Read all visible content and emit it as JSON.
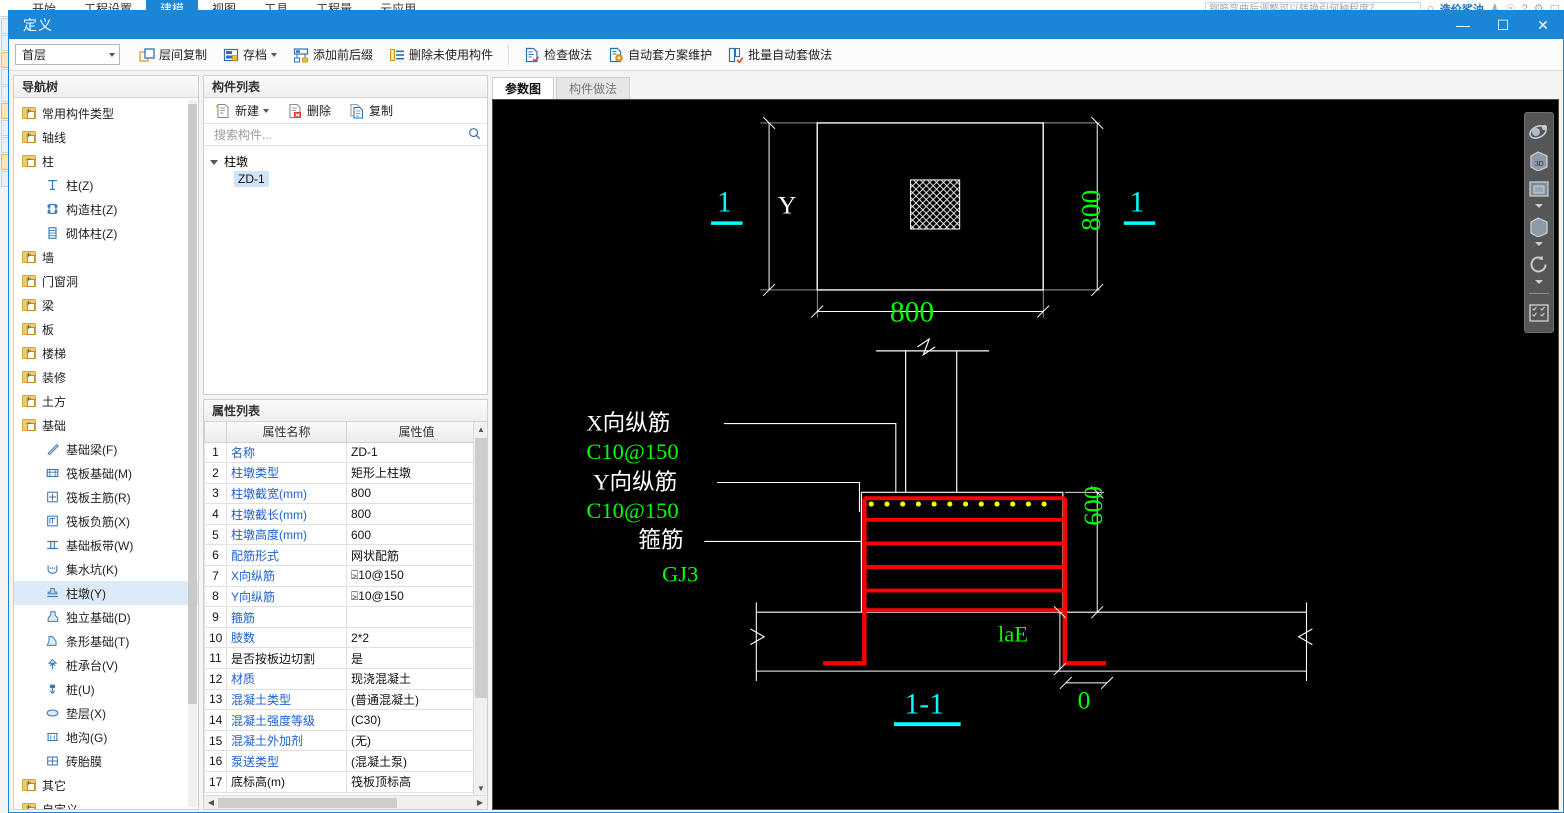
{
  "background_app": {
    "menu_items": [
      "开始",
      "工程设置",
      "建模",
      "视图",
      "工具",
      "工程量",
      "云应用"
    ],
    "active_menu": "建模",
    "search_placeholder": "钢筋弯曲后调整可以转换引何种程度？",
    "account_label": "造价鲨油",
    "help_glyph": "?"
  },
  "window": {
    "title": "定义",
    "minimize": "—",
    "maximize": "☐",
    "close": "✕"
  },
  "toolbar": {
    "floor_select": {
      "value": "首层",
      "options": [
        "首层"
      ]
    },
    "buttons": [
      {
        "label": "层间复制",
        "icon": "copy-between-floors-icon",
        "dropdown": false
      },
      {
        "label": "存档",
        "icon": "archive-icon",
        "dropdown": true
      },
      {
        "label": "添加前后缀",
        "icon": "add-prefix-suffix-icon",
        "dropdown": false
      },
      {
        "label": "删除未使用构件",
        "icon": "delete-unused-icon",
        "dropdown": false
      },
      {
        "label": "检查做法",
        "icon": "check-method-icon",
        "dropdown": false
      },
      {
        "label": "自动套方案维护",
        "icon": "auto-scheme-maintain-icon",
        "dropdown": false
      },
      {
        "label": "批量自动套做法",
        "icon": "batch-auto-method-icon",
        "dropdown": false
      }
    ]
  },
  "nav_panel": {
    "title": "导航树",
    "items": [
      {
        "label": "常用构件类型",
        "type": "folder",
        "state": "collapsed",
        "depth": 0
      },
      {
        "label": "轴线",
        "type": "folder",
        "state": "collapsed",
        "depth": 0
      },
      {
        "label": "柱",
        "type": "folder",
        "state": "expanded",
        "depth": 0
      },
      {
        "label": "柱(Z)",
        "type": "leaf",
        "icon": "column-icon",
        "depth": 1
      },
      {
        "label": "构造柱(Z)",
        "type": "leaf",
        "icon": "structural-column-icon",
        "depth": 1
      },
      {
        "label": "砌体柱(Z)",
        "type": "leaf",
        "icon": "masonry-column-icon",
        "depth": 1
      },
      {
        "label": "墙",
        "type": "folder",
        "state": "collapsed",
        "depth": 0
      },
      {
        "label": "门窗洞",
        "type": "folder",
        "state": "collapsed",
        "depth": 0
      },
      {
        "label": "梁",
        "type": "folder",
        "state": "collapsed",
        "depth": 0
      },
      {
        "label": "板",
        "type": "folder",
        "state": "collapsed",
        "depth": 0
      },
      {
        "label": "楼梯",
        "type": "folder",
        "state": "collapsed",
        "depth": 0
      },
      {
        "label": "装修",
        "type": "folder",
        "state": "collapsed",
        "depth": 0
      },
      {
        "label": "土方",
        "type": "folder",
        "state": "collapsed",
        "depth": 0
      },
      {
        "label": "基础",
        "type": "folder",
        "state": "expanded",
        "depth": 0
      },
      {
        "label": "基础梁(F)",
        "type": "leaf",
        "icon": "foundation-beam-icon",
        "depth": 1
      },
      {
        "label": "筏板基础(M)",
        "type": "leaf",
        "icon": "raft-foundation-icon",
        "depth": 1
      },
      {
        "label": "筏板主筋(R)",
        "type": "leaf",
        "icon": "raft-main-rebar-icon",
        "depth": 1
      },
      {
        "label": "筏板负筋(X)",
        "type": "leaf",
        "icon": "raft-negative-rebar-icon",
        "depth": 1
      },
      {
        "label": "基础板带(W)",
        "type": "leaf",
        "icon": "foundation-slab-band-icon",
        "depth": 1
      },
      {
        "label": "集水坑(K)",
        "type": "leaf",
        "icon": "sump-pit-icon",
        "depth": 1
      },
      {
        "label": "柱墩(Y)",
        "type": "leaf",
        "icon": "column-pedestal-icon",
        "depth": 1,
        "selected": true
      },
      {
        "label": "独立基础(D)",
        "type": "leaf",
        "icon": "isolated-foundation-icon",
        "depth": 1
      },
      {
        "label": "条形基础(T)",
        "type": "leaf",
        "icon": "strip-foundation-icon",
        "depth": 1
      },
      {
        "label": "桩承台(V)",
        "type": "leaf",
        "icon": "pile-cap-icon",
        "depth": 1
      },
      {
        "label": "桩(U)",
        "type": "leaf",
        "icon": "pile-icon",
        "depth": 1
      },
      {
        "label": "垫层(X)",
        "type": "leaf",
        "icon": "cushion-layer-icon",
        "depth": 1
      },
      {
        "label": "地沟(G)",
        "type": "leaf",
        "icon": "trench-icon",
        "depth": 1
      },
      {
        "label": "砖胎膜",
        "type": "leaf",
        "icon": "brick-formwork-icon",
        "depth": 1
      },
      {
        "label": "其它",
        "type": "folder",
        "state": "collapsed",
        "depth": 0
      },
      {
        "label": "自定义",
        "type": "folder",
        "state": "collapsed",
        "depth": 0
      }
    ]
  },
  "component_panel": {
    "title": "构件列表",
    "buttons": [
      {
        "label": "新建",
        "icon": "new-icon",
        "dropdown": true
      },
      {
        "label": "删除",
        "icon": "delete-icon",
        "dropdown": false
      },
      {
        "label": "复制",
        "icon": "copy-icon",
        "dropdown": false
      }
    ],
    "search_placeholder": "搜索构件...",
    "search_value": "",
    "group": "柱墩",
    "items": [
      {
        "label": "ZD-1",
        "selected": true
      }
    ]
  },
  "property_panel": {
    "title": "属性列表",
    "columns": [
      "",
      "属性名称",
      "属性值"
    ],
    "rows": [
      {
        "idx": "1",
        "name": "名称",
        "value": "ZD-1",
        "name_blue": true
      },
      {
        "idx": "2",
        "name": "柱墩类型",
        "value": "矩形上柱墩",
        "name_blue": true
      },
      {
        "idx": "3",
        "name": "柱墩截宽(mm)",
        "value": "800",
        "name_blue": true
      },
      {
        "idx": "4",
        "name": "柱墩截长(mm)",
        "value": "800",
        "name_blue": true
      },
      {
        "idx": "5",
        "name": "柱墩高度(mm)",
        "value": "600",
        "name_blue": true
      },
      {
        "idx": "6",
        "name": "配筋形式",
        "value": "网状配筋",
        "name_blue": true
      },
      {
        "idx": "7",
        "name": "X向纵筋",
        "value": "⍄10@150",
        "name_blue": true
      },
      {
        "idx": "8",
        "name": "Y向纵筋",
        "value": "⍄10@150",
        "name_blue": true
      },
      {
        "idx": "9",
        "name": "箍筋",
        "value": "",
        "name_blue": true
      },
      {
        "idx": "10",
        "name": "肢数",
        "value": "2*2",
        "name_blue": true
      },
      {
        "idx": "11",
        "name": "是否按板边切割",
        "value": "是",
        "name_blue": false
      },
      {
        "idx": "12",
        "name": "材质",
        "value": "现浇混凝土",
        "name_blue": true
      },
      {
        "idx": "13",
        "name": "混凝土类型",
        "value": "(普通混凝土)",
        "name_blue": true
      },
      {
        "idx": "14",
        "name": "混凝土强度等级",
        "value": "(C30)",
        "name_blue": true
      },
      {
        "idx": "15",
        "name": "混凝土外加剂",
        "value": "(无)",
        "name_blue": true
      },
      {
        "idx": "16",
        "name": "泵送类型",
        "value": "(混凝土泵)",
        "name_blue": true
      },
      {
        "idx": "17",
        "name": "底标高(m)",
        "value": "筏板顶标高",
        "name_blue": false
      }
    ]
  },
  "canvas": {
    "tabs": [
      {
        "label": "参数图",
        "active": true
      },
      {
        "label": "构件做法",
        "active": false
      }
    ],
    "drawing": {
      "plan_view": {
        "section_marker_left": "1",
        "section_marker_right": "1",
        "dim_y_label": "Y",
        "dim_right": "800",
        "dim_bottom": "800"
      },
      "section_view": {
        "title": "1-1",
        "callouts": [
          {
            "label": "X向纵筋",
            "value": "C10@150"
          },
          {
            "label": "Y向纵筋",
            "value": "C10@150"
          },
          {
            "label": "箍筋",
            "value": "GJ3"
          }
        ],
        "dim_height": "600",
        "dim_anchor": "laE",
        "dim_offset": "0"
      },
      "colors": {
        "background": "#000000",
        "geometry": "#ffffff",
        "dimension_text": "#00ff00",
        "rebar": "#ff0000",
        "rebar_dot": "#ffff00",
        "section_marker": "#00ffff"
      }
    }
  },
  "view_toolbar": {
    "items": [
      {
        "icon": "orbit-icon",
        "label": "动态观察",
        "dropdown": false
      },
      {
        "icon": "view-3d-icon",
        "label": "三维",
        "dropdown": false
      },
      {
        "icon": "view-box-open-icon",
        "label": "视图",
        "dropdown": true
      },
      {
        "icon": "view-box-icon",
        "label": "俯视",
        "dropdown": true
      },
      {
        "icon": "rotate-icon",
        "label": "旋转",
        "dropdown": true
      },
      {
        "icon": "display-settings-icon",
        "label": "显示设置",
        "dropdown": false
      }
    ]
  }
}
